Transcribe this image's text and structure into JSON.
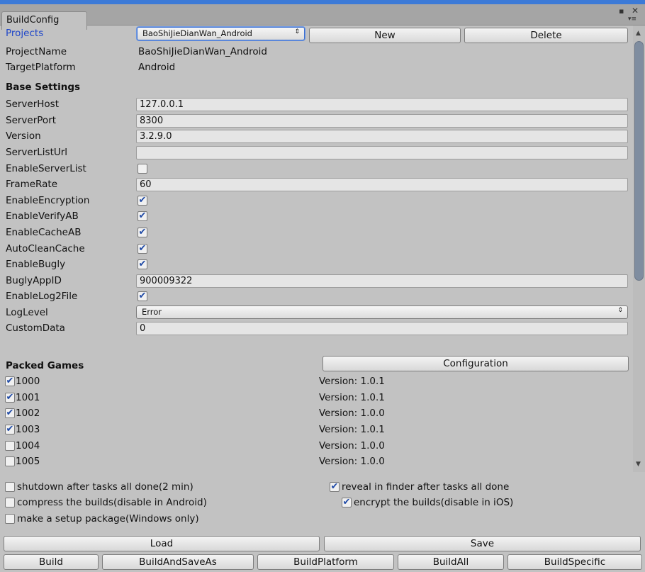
{
  "window": {
    "tab_title": "BuildConfig",
    "controls": {
      "maximize": "▪",
      "close": "✕",
      "menu": "▾≡"
    }
  },
  "projects": {
    "label": "Projects",
    "selected": "BaoShiJieDianWan_Android",
    "new_label": "New",
    "delete_label": "Delete"
  },
  "project_name": {
    "label": "ProjectName",
    "value": "BaoShiJieDianWan_Android"
  },
  "target_platform": {
    "label": "TargetPlatform",
    "value": "Android"
  },
  "base_settings": {
    "heading": "Base Settings",
    "server_host": {
      "label": "ServerHost",
      "value": "127.0.0.1"
    },
    "server_port": {
      "label": "ServerPort",
      "value": "8300"
    },
    "version": {
      "label": "Version",
      "value": "3.2.9.0"
    },
    "server_list_url": {
      "label": "ServerListUrl",
      "value": ""
    },
    "enable_server_list": {
      "label": "EnableServerList",
      "checked": false
    },
    "frame_rate": {
      "label": "FrameRate",
      "value": "60"
    },
    "enable_encryption": {
      "label": "EnableEncryption",
      "checked": true
    },
    "enable_verify_ab": {
      "label": "EnableVerifyAB",
      "checked": true
    },
    "enable_cache_ab": {
      "label": "EnableCacheAB",
      "checked": true
    },
    "auto_clean_cache": {
      "label": "AutoCleanCache",
      "checked": true
    },
    "enable_bugly": {
      "label": "EnableBugly",
      "checked": true
    },
    "bugly_app_id": {
      "label": "BuglyAppID",
      "value": "900009322"
    },
    "enable_log2file": {
      "label": "EnableLog2File",
      "checked": true
    },
    "log_level": {
      "label": "LogLevel",
      "value": "Error"
    },
    "custom_data": {
      "label": "CustomData",
      "value": "0"
    }
  },
  "packed_games": {
    "heading": "Packed Games",
    "configuration_label": "Configuration",
    "games": [
      {
        "id": "1000",
        "checked": true,
        "version": "Version: 1.0.1"
      },
      {
        "id": "1001",
        "checked": true,
        "version": "Version: 1.0.1"
      },
      {
        "id": "1002",
        "checked": true,
        "version": "Version: 1.0.0"
      },
      {
        "id": "1003",
        "checked": true,
        "version": "Version: 1.0.1"
      },
      {
        "id": "1004",
        "checked": false,
        "version": "Version: 1.0.0"
      },
      {
        "id": "1005",
        "checked": false,
        "version": "Version: 1.0.0"
      }
    ]
  },
  "options": {
    "shutdown": {
      "label": "shutdown after tasks all done(2 min)",
      "checked": false
    },
    "reveal": {
      "label": "reveal in finder after tasks all done",
      "checked": true
    },
    "compress": {
      "label": "compress the builds(disable in Android)",
      "checked": false
    },
    "encrypt": {
      "label": "encrypt the builds(disable in iOS)",
      "checked": true
    },
    "setup": {
      "label": "make a setup package(Windows only)",
      "checked": false
    }
  },
  "actions": {
    "load": "Load",
    "save": "Save",
    "build": "Build",
    "build_and_save_as": "BuildAndSaveAs",
    "build_platform": "BuildPlatform",
    "build_all": "BuildAll",
    "build_specific": "BuildSpecific"
  },
  "icons": {
    "check": "✔",
    "dropdown_arrow": "⇕",
    "scroll_up": "▲",
    "scroll_down": "▼"
  }
}
